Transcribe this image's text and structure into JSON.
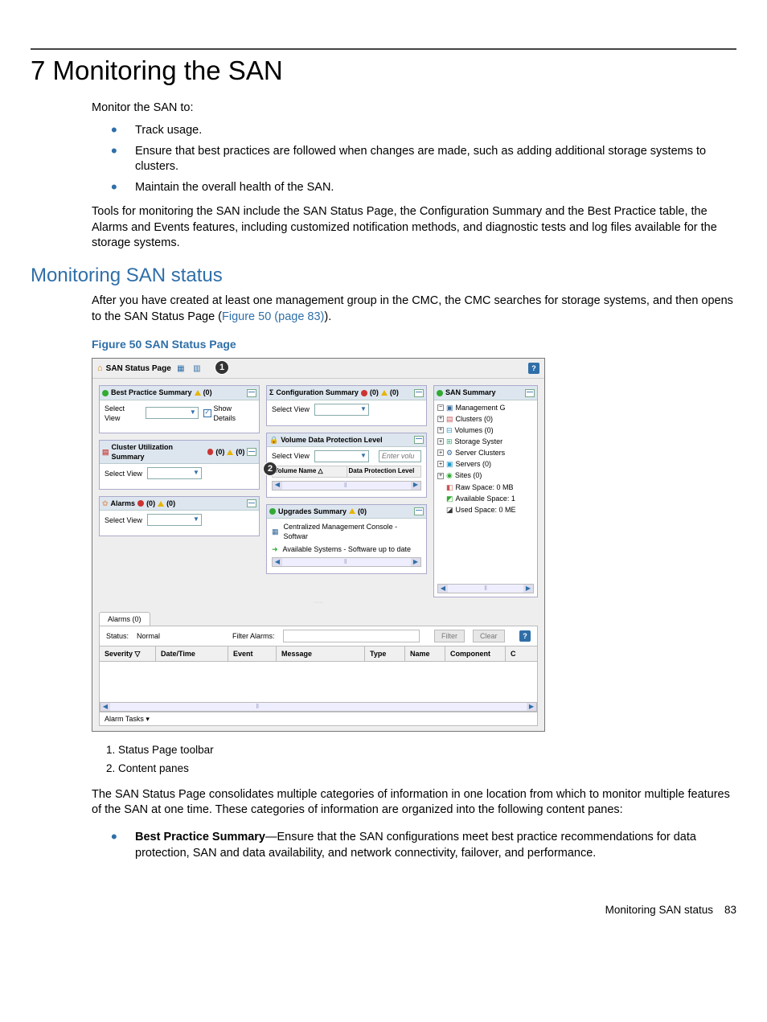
{
  "chapter": {
    "title": "7 Monitoring the SAN",
    "intro": "Monitor the SAN to:",
    "bullets": [
      "Track usage.",
      "Ensure that best practices are followed when changes are made, such as adding additional storage systems to clusters.",
      "Maintain the overall health of the SAN."
    ],
    "tools_para": "Tools for monitoring the SAN include the SAN Status Page, the Configuration Summary and the Best Practice table, the Alarms and Events features, including customized notification methods, and diagnostic tests and log files available for the storage systems."
  },
  "section": {
    "title": "Monitoring SAN status",
    "para_pre": "After you have created at least one management group in the CMC, the CMC searches for storage systems, and then opens to the SAN Status Page (",
    "xref": "Figure 50 (page 83)",
    "para_post": ")."
  },
  "figure": {
    "caption": "Figure 50 SAN Status Page",
    "callout1": "1",
    "callout2": "2",
    "toolbar_title": "SAN Status Page",
    "help": "?",
    "panels": {
      "bp": {
        "title": "Best Practice Summary",
        "warn_count": "(0)",
        "select": "Select View",
        "show_details": "Show Details"
      },
      "cluster": {
        "title": "Cluster Utilization Summary",
        "crit": "(0)",
        "warn": "(0)",
        "select": "Select View"
      },
      "alarms": {
        "title": "Alarms",
        "crit": "(0)",
        "warn": "(0)",
        "select": "Select View"
      },
      "config": {
        "title": "Configuration Summary",
        "crit": "(0)",
        "warn": "(0)",
        "select": "Select View",
        "sigma": "Σ"
      },
      "vdp": {
        "title": "Volume Data Protection Level",
        "select": "Select View",
        "placeholder": "Enter volu",
        "col1": "Volume Name",
        "col2": "Data Protection Level"
      },
      "upg": {
        "title": "Upgrades Summary",
        "warn": "(0)",
        "line1": "Centralized Management Console - Softwar",
        "line2": "Available Systems - Software up to date"
      },
      "san": {
        "title": "SAN Summary",
        "tree": [
          "Management G",
          "Clusters (0)",
          "Volumes (0)",
          "Storage Syster",
          "Server Clusters",
          "Servers (0)",
          "Sites (0)"
        ],
        "stats": [
          "Raw Space: 0 MB",
          "Available Space: 1",
          "Used Space: 0 ME"
        ]
      }
    },
    "alarms_section": {
      "tab": "Alarms (0)",
      "status_label": "Status:",
      "status_value": "Normal",
      "filter_label": "Filter Alarms:",
      "filter_btn": "Filter",
      "clear_btn": "Clear",
      "cols": [
        "Severity",
        "Date/Time",
        "Event",
        "Message",
        "Type",
        "Name",
        "Component",
        "C"
      ],
      "tasks": "Alarm Tasks ▾"
    }
  },
  "legend": {
    "i1": "1. Status Page toolbar",
    "i2": "2. Content panes"
  },
  "after_fig": {
    "para": "The SAN Status Page consolidates multiple categories of information in one location from which to monitor multiple features of the SAN at one time. These categories of information are organized into the following content panes:",
    "feat_label": "Best Practice Summary",
    "feat_text": "—Ensure that the SAN configurations meet best practice recommendations for data protection, SAN and data availability, and network connectivity, failover, and performance."
  },
  "footer": {
    "section": "Monitoring SAN status",
    "page": "83"
  }
}
